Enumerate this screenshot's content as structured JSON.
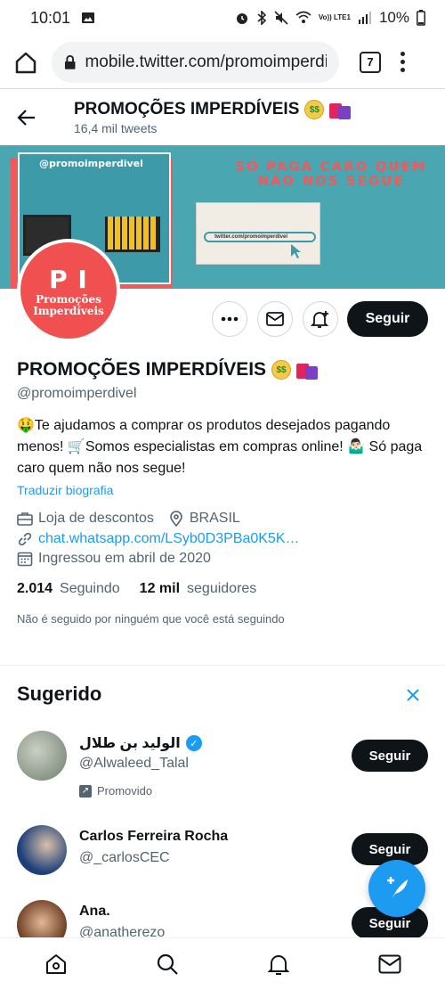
{
  "status_bar": {
    "time": "10:01",
    "network": "Vo)) LTE1",
    "battery": "10%",
    "icons": [
      "gallery-icon",
      "alarm-icon",
      "bluetooth-icon",
      "mute-icon",
      "wifi-icon",
      "signal-icon",
      "battery-icon"
    ]
  },
  "browser": {
    "url": "mobile.twitter.com/promoimperdiv",
    "tab_count": "7"
  },
  "profile_header": {
    "name": "PROMOÇÕES IMPERDÍVEIS",
    "tweets": "16,4 mil tweets"
  },
  "banner": {
    "handle": "@promoimperdivel",
    "slogan": "SÓ PAGA CARO QUEM NÃO NOS SEGUE",
    "url": "twitter.com/promoimperdivel"
  },
  "avatar": {
    "initials": "P I",
    "text": "Promoções Imperdíveis"
  },
  "actions": {
    "follow": "Seguir"
  },
  "profile": {
    "name": "PROMOÇÕES IMPERDÍVEIS",
    "handle": "@promoimperdivel",
    "bio": "🤑Te ajudamos a comprar os produtos desejados pagando menos! 🛒Somos especialistas em compras online! 🤷🏻‍♂️ Só paga caro quem não nos segue!",
    "translate": "Traduzir biografia",
    "category": "Loja de descontos",
    "location": "BRASIL",
    "link": "chat.whatsapp.com/LSyb0D3PBa0K5K…",
    "joined": "Ingressou em abril de 2020",
    "following_count": "2.014",
    "following_label": "Seguindo",
    "followers_count": "12 mil",
    "followers_label": "seguidores",
    "not_followed": "Não é seguido por ninguém que você está seguindo"
  },
  "suggested": {
    "title": "Sugerido",
    "items": [
      {
        "name": "الوليد بن طلال",
        "handle": "@Alwaleed_Talal",
        "promoted": "Promovido",
        "button": "Seguir",
        "avatar_color": "#8a9a8a"
      },
      {
        "name": "Carlos Ferreira Rocha",
        "handle": "@_carlosCEC",
        "button": "Seguir",
        "avatar_color": "#2a4a8a"
      },
      {
        "name": "Ana.",
        "handle": "@anatherezo",
        "button": "Seguir",
        "avatar_color": "#c08a6a"
      }
    ]
  },
  "colors": {
    "accent": "#1d9bf0",
    "text": "#0f1419",
    "muted": "#536471",
    "banner": "#4aa6b0",
    "brand_red": "#f05050"
  }
}
